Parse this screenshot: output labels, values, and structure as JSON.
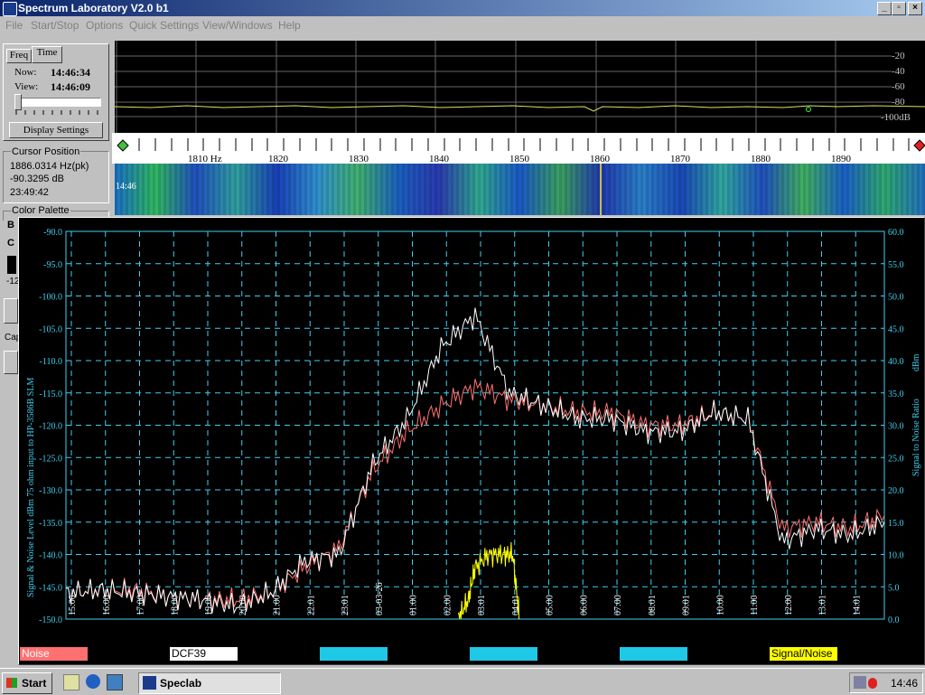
{
  "window": {
    "title": "Spectrum Laboratory V2.0 b1",
    "buttons": [
      "_",
      "▫",
      "×"
    ]
  },
  "menu": [
    {
      "label": "File"
    },
    {
      "label": "Start/Stop"
    },
    {
      "label": "Options"
    },
    {
      "label": "Quick Settings"
    },
    {
      "label": "View/Windows"
    },
    {
      "label": "Help"
    }
  ],
  "time_panel": {
    "tabs": [
      "Freq",
      "Time"
    ],
    "now_label": "Now:",
    "now_value": "14:46:34",
    "view_label": "View:",
    "view_value": "14:46:09",
    "display_settings": "Display Settings"
  },
  "cursor_panel": {
    "title": "Cursor Position",
    "freq": "1886.0314 Hz(pk)",
    "level": "-90.3295 dB",
    "time": "23:49:42"
  },
  "palette_panel": {
    "title": "Color Palette",
    "b_label": "B",
    "c_label": "C",
    "value": "-12",
    "cap_label": "Cap"
  },
  "spectrum": {
    "db_labels": [
      "-20",
      "-40",
      "-60",
      "-80",
      "-100dB"
    ],
    "freq_labels": [
      "1810 Hz",
      "1820",
      "1830",
      "1840",
      "1850",
      "1860",
      "1870",
      "1880",
      "1890"
    ],
    "waterfall_time": "14:46"
  },
  "plot": {
    "left_axis_title": "Signal & Noise Level  dBm 75 ohm input to HP-3586B SLM",
    "right_axis_title_1": "Signal to Noise Ratio",
    "right_axis_title_2": "dBm",
    "left_ticks": [
      "-90.0",
      "-95.0",
      "-100.0",
      "-105.0",
      "-110.0",
      "-115.0",
      "-120.0",
      "-125.0",
      "-130.0",
      "-135.0",
      "-140.0",
      "-145.0",
      "-150.0"
    ],
    "right_ticks": [
      "60.0",
      "55.0",
      "50.0",
      "45.0",
      "40.0",
      "35.0",
      "30.0",
      "25.0",
      "20.0",
      "15.0",
      "10.0",
      "5.0",
      "0.0"
    ],
    "time_labels": [
      "15:00",
      "16:00",
      "17:00",
      "18:00",
      "19:00",
      "20:00",
      "21:00",
      "22:01",
      "23:01",
      "03-03-26",
      "01:00",
      "02:00",
      "03:01",
      "04:01",
      "05:00",
      "06:00",
      "07:00",
      "08:01",
      "09:01",
      "10:00",
      "11:00",
      "12:00",
      "13:01",
      "14:01"
    ]
  },
  "legend": [
    {
      "label": "Noise",
      "bg": "#ff7070",
      "fg": "#ffffff"
    },
    {
      "label": "DCF39",
      "bg": "#ffffff",
      "fg": "#000000"
    },
    {
      "label": "",
      "bg": "#20c8e8",
      "fg": "#000000"
    },
    {
      "label": "",
      "bg": "#20c8e8",
      "fg": "#000000"
    },
    {
      "label": "",
      "bg": "#20c8e8",
      "fg": "#000000"
    },
    {
      "label": "Signal/Noise",
      "bg": "#ffff00",
      "fg": "#000000"
    }
  ],
  "chart_data": {
    "type": "line",
    "title": "",
    "ylabel": "Signal & Noise Level  dBm 75 ohm input to HP-3586B SLM",
    "y2label": "Signal to Noise Ratio dBm",
    "ylim": [
      -150,
      -90
    ],
    "y2lim": [
      0,
      60
    ],
    "x_labels": [
      "15:00",
      "16:00",
      "17:00",
      "18:00",
      "19:00",
      "20:00",
      "21:00",
      "22:01",
      "23:01",
      "03-03-26",
      "01:00",
      "02:00",
      "03:01",
      "04:01",
      "05:00",
      "06:00",
      "07:00",
      "08:01",
      "09:01",
      "10:00",
      "11:00",
      "12:00",
      "13:01",
      "14:01"
    ],
    "grid": true,
    "series": [
      {
        "name": "Noise",
        "color": "#ff7070",
        "axis": "left",
        "x": [
          0,
          1,
          2,
          3,
          4,
          5,
          6,
          7,
          8,
          9,
          10,
          11,
          12,
          13,
          14,
          15,
          16,
          17,
          18,
          19,
          20,
          21,
          22,
          23,
          24
        ],
        "values": [
          -146,
          -145.5,
          -145.5,
          -146.5,
          -147,
          -147,
          -146,
          -142,
          -139,
          -127,
          -121,
          -117,
          -114,
          -116,
          -117,
          -118,
          -118,
          -120,
          -120,
          -118,
          -119,
          -136,
          -135,
          -136,
          -134
        ]
      },
      {
        "name": "DCF39",
        "color": "#ffffff",
        "axis": "left",
        "x": [
          0,
          1,
          2,
          3,
          4,
          5,
          6,
          7,
          8,
          9,
          10,
          11,
          12,
          13,
          14,
          15,
          16,
          17,
          18,
          19,
          20,
          21,
          22,
          23,
          24
        ],
        "values": [
          -146,
          -145.5,
          -146,
          -146.5,
          -147,
          -148,
          -146,
          -141,
          -140,
          -126,
          -119,
          -108,
          -103,
          -115,
          -117,
          -119,
          -119,
          -121,
          -121,
          -118,
          -119,
          -138,
          -136,
          -137,
          -135
        ]
      },
      {
        "name": "Signal/Noise",
        "color": "#ffff00",
        "axis": "right",
        "x": [
          11.5,
          11.8,
          12,
          12.4,
          12.8,
          13.1,
          13.3
        ],
        "values": [
          0,
          3,
          8,
          10,
          10,
          10,
          0
        ]
      }
    ]
  },
  "taskbar": {
    "start": "Start",
    "task": "Speclab",
    "clock": "14:46"
  }
}
